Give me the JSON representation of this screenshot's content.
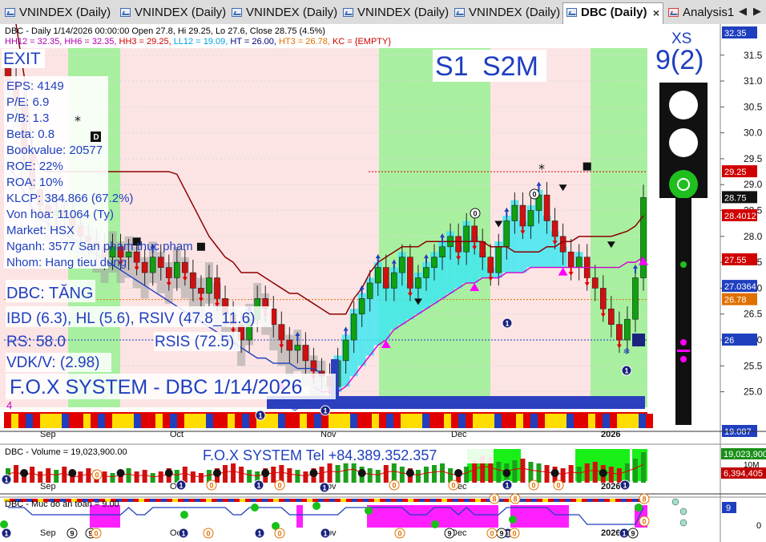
{
  "tabs": [
    {
      "label": "VNINDEX (Daily)",
      "active": false
    },
    {
      "label": "VNINDEX (Daily)",
      "active": false
    },
    {
      "label": "VNINDEX (Daily)",
      "active": false
    },
    {
      "label": "VNINDEX (Daily)",
      "active": false
    },
    {
      "label": "VNINDEX (Daily)",
      "active": false
    },
    {
      "label": "DBC (Daily)",
      "active": true
    },
    {
      "label": "Analysis1",
      "active": false
    }
  ],
  "tab_close": "×",
  "nav": {
    "prev": "◀",
    "next": "▶"
  },
  "header": {
    "line1": "DBC - Daily 1/14/2026 00:00:00 Open 27.8, Hi 29.25, Lo 27.6, Close 28.75 (4.5%)",
    "line2": [
      {
        "text": "HH12 = 32.35, ",
        "color": "#b000b0"
      },
      {
        "text": "HH6 = 32.35, ",
        "color": "#b000b0"
      },
      {
        "text": "HH3 = 29.25, ",
        "color": "#d00000"
      },
      {
        "text": "LL12 = 19.09, ",
        "color": "#00a0e0"
      },
      {
        "text": "HT = 26.00, ",
        "color": "#000080"
      },
      {
        "text": "HT3 = 26.78, ",
        "color": "#e07000"
      },
      {
        "text": "KC = {EMPTY}",
        "color": "#d00000"
      }
    ]
  },
  "left_info": {
    "exit": "EXIT",
    "stats": [
      "EPS: 4149",
      "P/E: 6.9",
      "P/B: 1.3",
      "Beta: 0.8",
      "Bookvalue: 20577",
      "ROE: 22%",
      "ROA: 10%",
      "KLCP: 384.866 (67.2%)",
      "Von hoa: 11064 (Ty)",
      "Market: HSX",
      "Nganh: 3577 San pham thuc pham",
      "Nhom: Hang tieu dung"
    ],
    "trend": "DBC: TĂNG",
    "ibd": "IBD (6.3), HL (5.6), RSIV (47.8_11.6)",
    "rs": "RS: 58.0",
    "rsis": "RSIS (72.5)",
    "vdk": "VDK/V:  (2.98)",
    "fox": "F.O.X SYSTEM - DBC 1/14/2026",
    "count": "4"
  },
  "signals": {
    "s1": "S1",
    "s2m": "S2M"
  },
  "xs": {
    "label": "XS",
    "value": "9(2)"
  },
  "markers": {
    "d": "D",
    "zero": "0",
    "one": "1",
    "eight": "8",
    "nine": "9",
    "star": "*",
    "snow": "❄"
  },
  "price_axis": {
    "ticks": [
      31.5,
      31.0,
      30.5,
      30.0,
      29.5,
      29.0,
      28.5,
      28.0,
      27.5,
      27.0,
      26.5,
      26.0,
      25.5,
      25.0
    ],
    "labels": [
      {
        "value": 32.35,
        "text": "32.35",
        "bg": "#1f3fbf"
      },
      {
        "value": 29.25,
        "text": "29.25",
        "bg": "#d00000"
      },
      {
        "value": 28.75,
        "text": "28.75",
        "bg": "#111111"
      },
      {
        "value": 28.4012,
        "text": "28.4012",
        "bg": "#d00000"
      },
      {
        "value": 27.55,
        "text": "27.55",
        "bg": "#d00000"
      },
      {
        "value": 27.0364,
        "text": "27.0364",
        "bg": "#1f3fbf"
      },
      {
        "value": 26.78,
        "text": "26.78",
        "bg": "#e07000"
      },
      {
        "value": 26.0,
        "text": "26",
        "bg": "#1f3fbf"
      },
      {
        "value": 19.087,
        "text": "19.087",
        "bg": "#1f3fbf"
      }
    ]
  },
  "date_labels": [
    "Sep",
    "Oct",
    "Nov",
    "Dec",
    "2026"
  ],
  "volume": {
    "title": "DBC - Volume = 19,023,900.00",
    "tel": "F.O.X SYSTEM Tel +84.389.352.357",
    "axis": "10M",
    "labels": [
      {
        "text": "19,023,900",
        "bg": "#1a8f1a"
      },
      {
        "text": "6,394,405",
        "bg": "#c00000"
      }
    ]
  },
  "safety": {
    "title": "DBC - Muc do an toan = 9.00",
    "label": "9",
    "axis": "0"
  },
  "chart_data": {
    "type": "candlestick",
    "symbol": "DBC",
    "period": "Daily",
    "date": "1/14/2026",
    "last": {
      "open": 27.8,
      "high": 29.25,
      "low": 27.6,
      "close": 28.75,
      "change_pct": 4.5
    },
    "ylim": [
      24.7,
      32.1
    ],
    "closes": [
      31.0,
      30.6,
      29.6,
      28.9,
      28.6,
      28.4,
      28.5,
      28.4,
      28.2,
      28.0,
      27.9,
      27.8,
      27.6,
      27.8,
      27.6,
      27.7,
      27.5,
      27.3,
      27.6,
      27.4,
      27.2,
      27.5,
      27.3,
      27.0,
      26.9,
      27.2,
      26.8,
      26.5,
      26.3,
      26.0,
      26.4,
      26.8,
      26.6,
      26.3,
      26.0,
      25.8,
      25.9,
      25.6,
      25.4,
      25.3,
      25.1,
      25.6,
      26.0,
      26.5,
      26.8,
      27.1,
      27.4,
      27.0,
      27.3,
      27.6,
      27.0,
      27.2,
      27.4,
      27.6,
      27.8,
      28.0,
      27.7,
      28.2,
      27.9,
      27.6,
      27.3,
      27.8,
      28.3,
      28.6,
      28.2,
      28.5,
      28.8,
      28.3,
      28.0,
      27.7,
      27.4,
      27.6,
      27.2,
      27.0,
      26.6,
      26.3,
      26.0,
      26.4,
      27.2,
      28.75
    ],
    "trailing_stop": [
      32.6,
      32.1,
      31.1,
      29.7,
      29.3,
      29.25,
      29.25,
      29.25,
      29.25,
      29.25,
      29.25,
      29.25,
      29.25,
      29.25,
      29.25,
      29.25,
      29.25,
      29.25,
      29.25,
      29.25,
      29.25,
      29.2,
      28.9,
      28.6,
      28.3,
      28.0,
      27.8,
      27.6,
      27.5,
      27.3,
      27.3,
      27.3,
      27.2,
      27.1,
      27.0,
      26.9,
      26.9,
      26.8,
      26.7,
      26.6,
      26.5,
      26.5,
      26.5,
      26.8,
      27.0,
      27.3,
      27.5,
      27.6,
      27.7,
      27.8,
      27.8,
      27.8,
      27.9,
      27.9,
      27.9,
      27.9,
      27.9,
      27.9,
      27.9,
      27.9,
      27.8,
      27.8,
      27.8,
      27.7,
      27.7,
      27.7,
      27.7,
      27.8,
      27.8,
      27.9,
      27.9,
      28.0,
      28.0,
      28.0,
      28.0,
      28.0,
      28.05,
      28.1,
      28.2,
      28.4
    ],
    "lower_band": [
      29.0,
      28.8,
      28.5,
      28.2,
      28.0,
      27.9,
      27.8,
      27.7,
      27.6,
      27.5,
      27.4,
      27.3,
      27.2,
      27.1,
      27.0,
      26.9,
      26.8,
      26.7,
      26.6,
      26.5,
      26.4,
      26.3,
      26.2,
      26.1,
      26.0,
      25.9,
      25.8,
      25.7,
      25.6,
      25.5,
      25.4,
      25.3,
      25.3,
      25.2,
      25.2,
      25.2,
      25.1,
      25.1,
      25.1,
      25.0,
      25.0,
      25.0,
      25.1,
      25.3,
      25.5,
      25.7,
      25.9,
      26.0,
      26.2,
      26.3,
      26.4,
      26.5,
      26.6,
      26.7,
      26.8,
      26.9,
      27.0,
      27.1,
      27.1,
      27.2,
      27.2,
      27.2,
      27.3,
      27.3,
      27.3,
      27.4,
      27.4,
      27.4,
      27.4,
      27.4,
      27.4,
      27.4,
      27.4,
      27.4,
      27.4,
      27.4,
      27.4,
      27.5,
      27.5,
      27.6
    ],
    "hlines": {
      "ht": 26.0,
      "ht3": 26.78,
      "hh3": 29.25,
      "hh12": 32.35,
      "ll12": 19.09
    },
    "volume_values": [
      9,
      11,
      8,
      10,
      7,
      9,
      8,
      10,
      6,
      7,
      9,
      8,
      7,
      6,
      8,
      9,
      7,
      8,
      6,
      7,
      9,
      8,
      10,
      7,
      6,
      8,
      9,
      11,
      12,
      10,
      8,
      7,
      9,
      10,
      11,
      9,
      8,
      7,
      9,
      10,
      12,
      11,
      13,
      14,
      10,
      9,
      8,
      11,
      12,
      10,
      9,
      8,
      10,
      11,
      12,
      9,
      8,
      10,
      14,
      17,
      16,
      13,
      12,
      14,
      15,
      13,
      12,
      11,
      10,
      9,
      11,
      10,
      12,
      13,
      11,
      10,
      9,
      12,
      15,
      19.02
    ]
  }
}
